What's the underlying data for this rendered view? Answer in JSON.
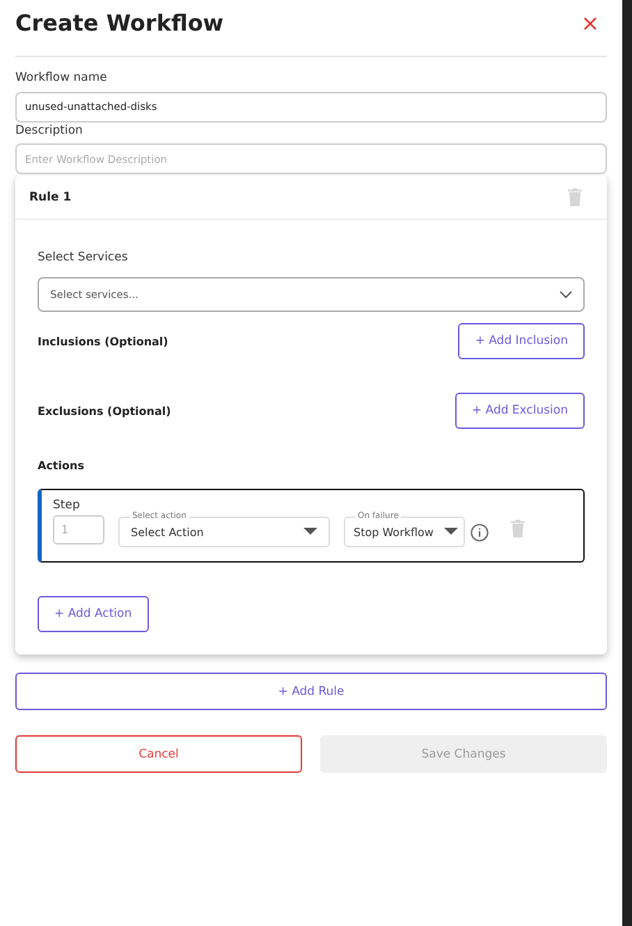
{
  "title": "Create Workflow",
  "fields": [
    {
      "label": "Workflow name",
      "value": "unused-unattached-disks"
    },
    {
      "label": "Description",
      "placeholder": "Enter Workflow Description"
    }
  ],
  "rules": [
    {
      "title": "Rule 1",
      "services": {
        "label": "Select Services",
        "placeholder": "Select services..."
      },
      "inclusions": {
        "label": "Inclusions (Optional)",
        "button": "+ Add Inclusion"
      },
      "exclusions": {
        "label": "Exclusions (Optional)",
        "button": "+ Add Exclusion"
      },
      "actions_label": "Actions",
      "actions": [
        {
          "step_label": "Step",
          "step": "1",
          "action_label": "Select action",
          "action": "Select Action",
          "failure_label": "On failure",
          "failure": "Stop Workflow"
        }
      ],
      "add_action": "+ Add Action"
    }
  ],
  "add_rule": "+ Add Rule",
  "buttons": [
    {
      "label": "Cancel",
      "kind": "secondary",
      "disabled": false
    },
    {
      "label": "Save Changes",
      "kind": "primary",
      "disabled": true
    }
  ]
}
